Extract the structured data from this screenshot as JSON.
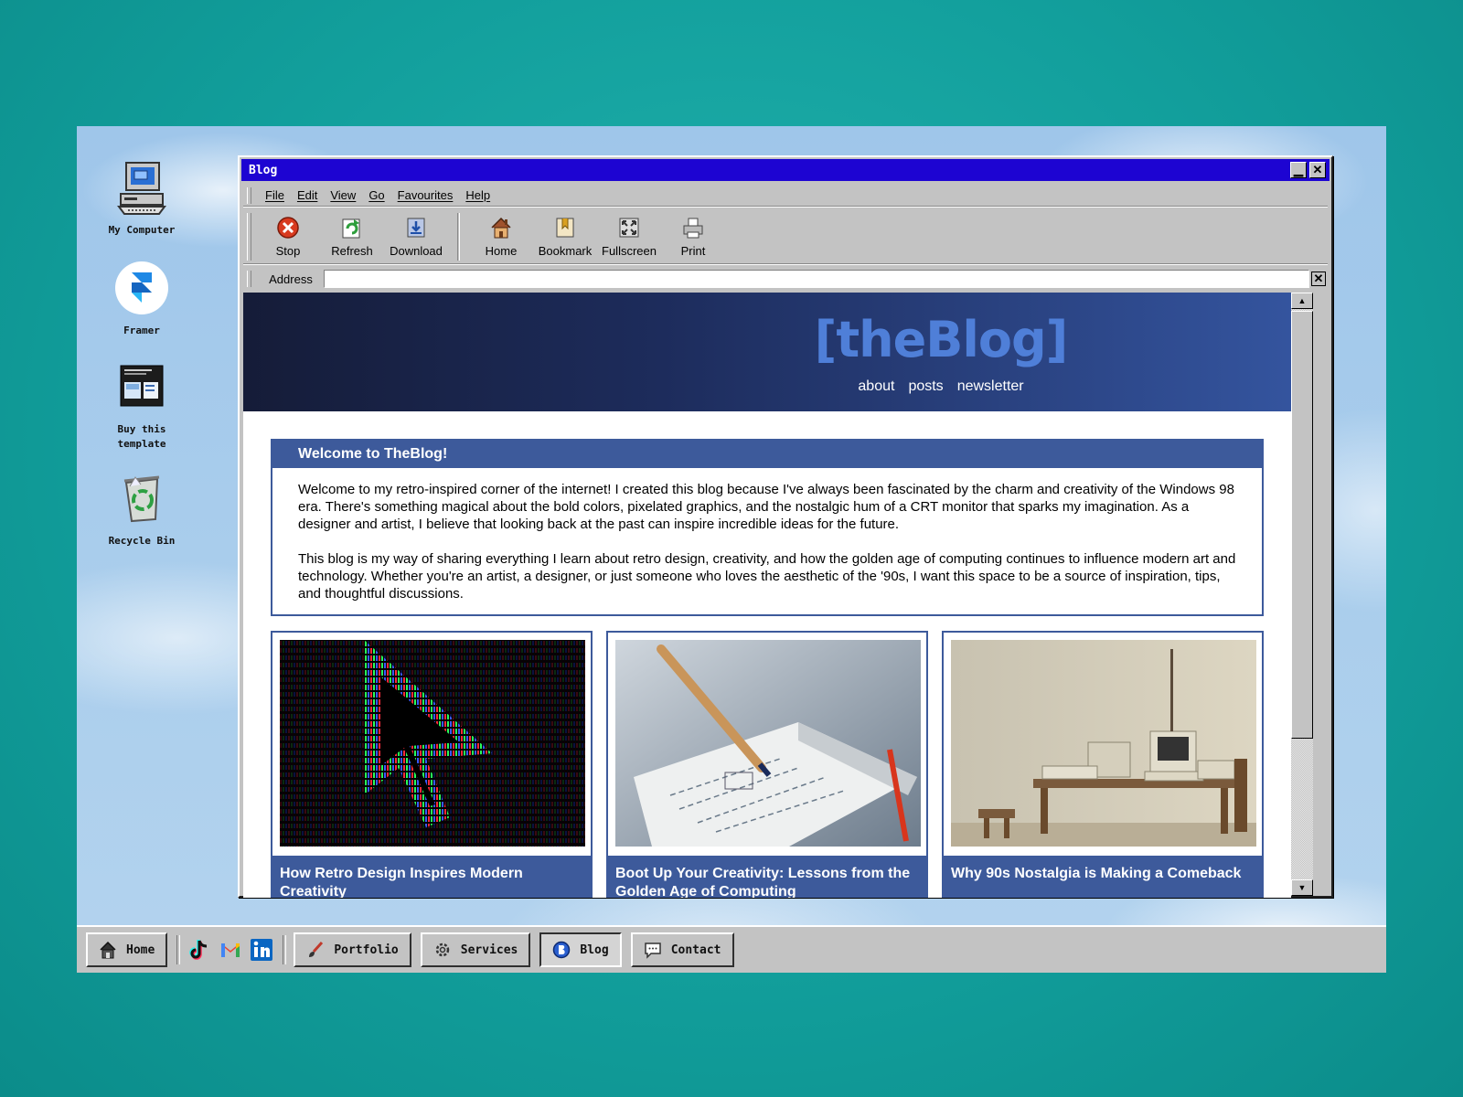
{
  "desktop": {
    "icons": [
      {
        "label": "My Computer",
        "icon": "computer-icon"
      },
      {
        "label": "Framer",
        "icon": "framer-icon"
      },
      {
        "label": "Buy this template",
        "icon": "template-icon"
      },
      {
        "label": "Recycle Bin",
        "icon": "recycle-bin-icon"
      }
    ]
  },
  "window": {
    "title": "Blog",
    "minimize_label": "▁",
    "close_label": "✕",
    "menu": [
      "File",
      "Edit",
      "View",
      "Go",
      "Favourites",
      "Help"
    ],
    "toolbar": [
      {
        "label": "Stop",
        "icon": "stop-icon"
      },
      {
        "label": "Refresh",
        "icon": "refresh-icon"
      },
      {
        "label": "Download",
        "icon": "download-icon"
      },
      {
        "label": "Home",
        "icon": "home-icon"
      },
      {
        "label": "Bookmark",
        "icon": "bookmark-icon"
      },
      {
        "label": "Fullscreen",
        "icon": "fullscreen-icon"
      },
      {
        "label": "Print",
        "icon": "print-icon"
      }
    ],
    "address": {
      "label": "Address",
      "value": "",
      "close_label": "✕"
    }
  },
  "page": {
    "logo": "[theBlog]",
    "nav": [
      "about",
      "posts",
      "newsletter"
    ],
    "welcome": {
      "title": "Welcome to TheBlog!",
      "paragraphs": [
        "Welcome to my retro-inspired corner of the internet! I created this blog because I've always been fascinated by the charm and creativity of the Windows 98 era. There's something magical about the bold colors, pixelated graphics, and the nostalgic hum of a CRT monitor that sparks my imagination. As a designer and artist, I believe that looking back at the past can inspire incredible ideas for the future.",
        "This blog is my way of sharing everything I learn about retro design, creativity, and how the golden age of computing continues to influence modern art and technology. Whether you're an artist, a designer, or just someone who loves the aesthetic of the '90s, I want this space to be a source of inspiration, tips, and thoughtful discussions."
      ]
    },
    "posts": [
      {
        "title": "How Retro Design Inspires Modern Creativity"
      },
      {
        "title": "Boot Up Your Creativity: Lessons from the Golden Age of Computing"
      },
      {
        "title": "Why 90s Nostalgia is Making a Comeback"
      }
    ]
  },
  "taskbar": {
    "items": [
      {
        "label": "Home",
        "icon": "house-icon"
      },
      {
        "label": "Portfolio",
        "icon": "brush-icon"
      },
      {
        "label": "Services",
        "icon": "gear-icon"
      },
      {
        "label": "Blog",
        "icon": "blog-icon",
        "active": true
      },
      {
        "label": "Contact",
        "icon": "chat-icon"
      }
    ],
    "social": [
      "tiktok-icon",
      "gmail-icon",
      "linkedin-icon"
    ]
  },
  "colors": {
    "titlebar": "#1d04d2",
    "accent": "#3d5a9b",
    "logo": "#4f7fd8",
    "chrome": "#c3c3c3"
  }
}
